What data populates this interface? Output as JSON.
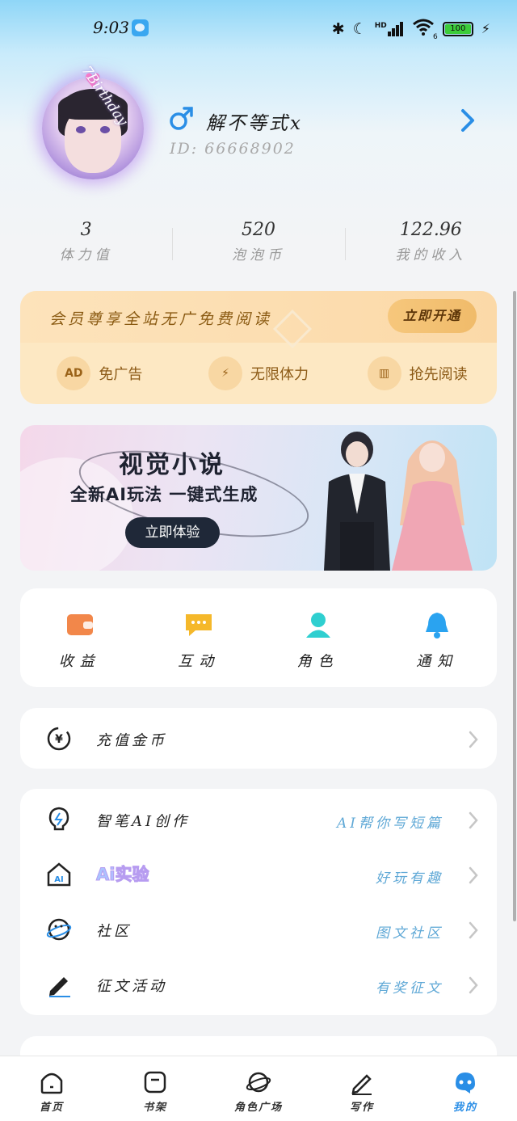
{
  "status_bar": {
    "time": "9:03",
    "network_badge": "HD",
    "wifi_badge": "6",
    "battery": "100"
  },
  "profile": {
    "avatar_caption": "7Birthday",
    "gender_icon": "male-icon",
    "username": "解不等式x",
    "user_id": "ID: 66668902"
  },
  "stats": [
    {
      "value": "3",
      "label": "体力值"
    },
    {
      "value": "520",
      "label": "泡泡币"
    },
    {
      "value": "122.96",
      "label": "我的收入"
    }
  ],
  "vip": {
    "title": "会员尊享全站无广免费阅读",
    "button": "立即开通",
    "perks": [
      {
        "icon": "ad-icon",
        "icon_text": "AD",
        "label": "免广告"
      },
      {
        "icon": "lightning-icon",
        "icon_text": "⚡",
        "label": "无限体力"
      },
      {
        "icon": "book-icon",
        "icon_text": "▥",
        "label": "抢先阅读"
      }
    ]
  },
  "banner": {
    "title": "视觉小说",
    "subtitle": "全新AI玩法 一键式生成",
    "button": "立即体验"
  },
  "quick_actions": [
    {
      "icon": "wallet-icon",
      "label": "收益",
      "color": "#f2874a"
    },
    {
      "icon": "chat-icon",
      "label": "互动",
      "color": "#f5b82a"
    },
    {
      "icon": "person-icon",
      "label": "角色",
      "color": "#2fcfd0"
    },
    {
      "icon": "bell-icon",
      "label": "通知",
      "color": "#2aa3f0"
    }
  ],
  "recharge": {
    "label": "充值金币"
  },
  "features": [
    {
      "icon": "lightbulb-icon",
      "label": "智笔AI创作",
      "hint": "AI帮你写短篇"
    },
    {
      "icon": "ai-house-icon",
      "label": "Ai实验",
      "hint": "好玩有趣"
    },
    {
      "icon": "planet-icon",
      "label": "社区",
      "hint": "图文社区"
    },
    {
      "icon": "pen-icon",
      "label": "征文活动",
      "hint": "有奖征文"
    }
  ],
  "bottom_nav": [
    {
      "icon": "home-icon",
      "label": "首页",
      "active": false
    },
    {
      "icon": "bookshelf-icon",
      "label": "书架",
      "active": false
    },
    {
      "icon": "planet-nav-icon",
      "label": "角色广场",
      "active": false
    },
    {
      "icon": "write-icon",
      "label": "写作",
      "active": false
    },
    {
      "icon": "mine-icon",
      "label": "我的",
      "active": true
    }
  ],
  "colors": {
    "accent": "#2a8ee6",
    "vip_text": "#8a5a12",
    "hint": "#5fa8d6"
  }
}
